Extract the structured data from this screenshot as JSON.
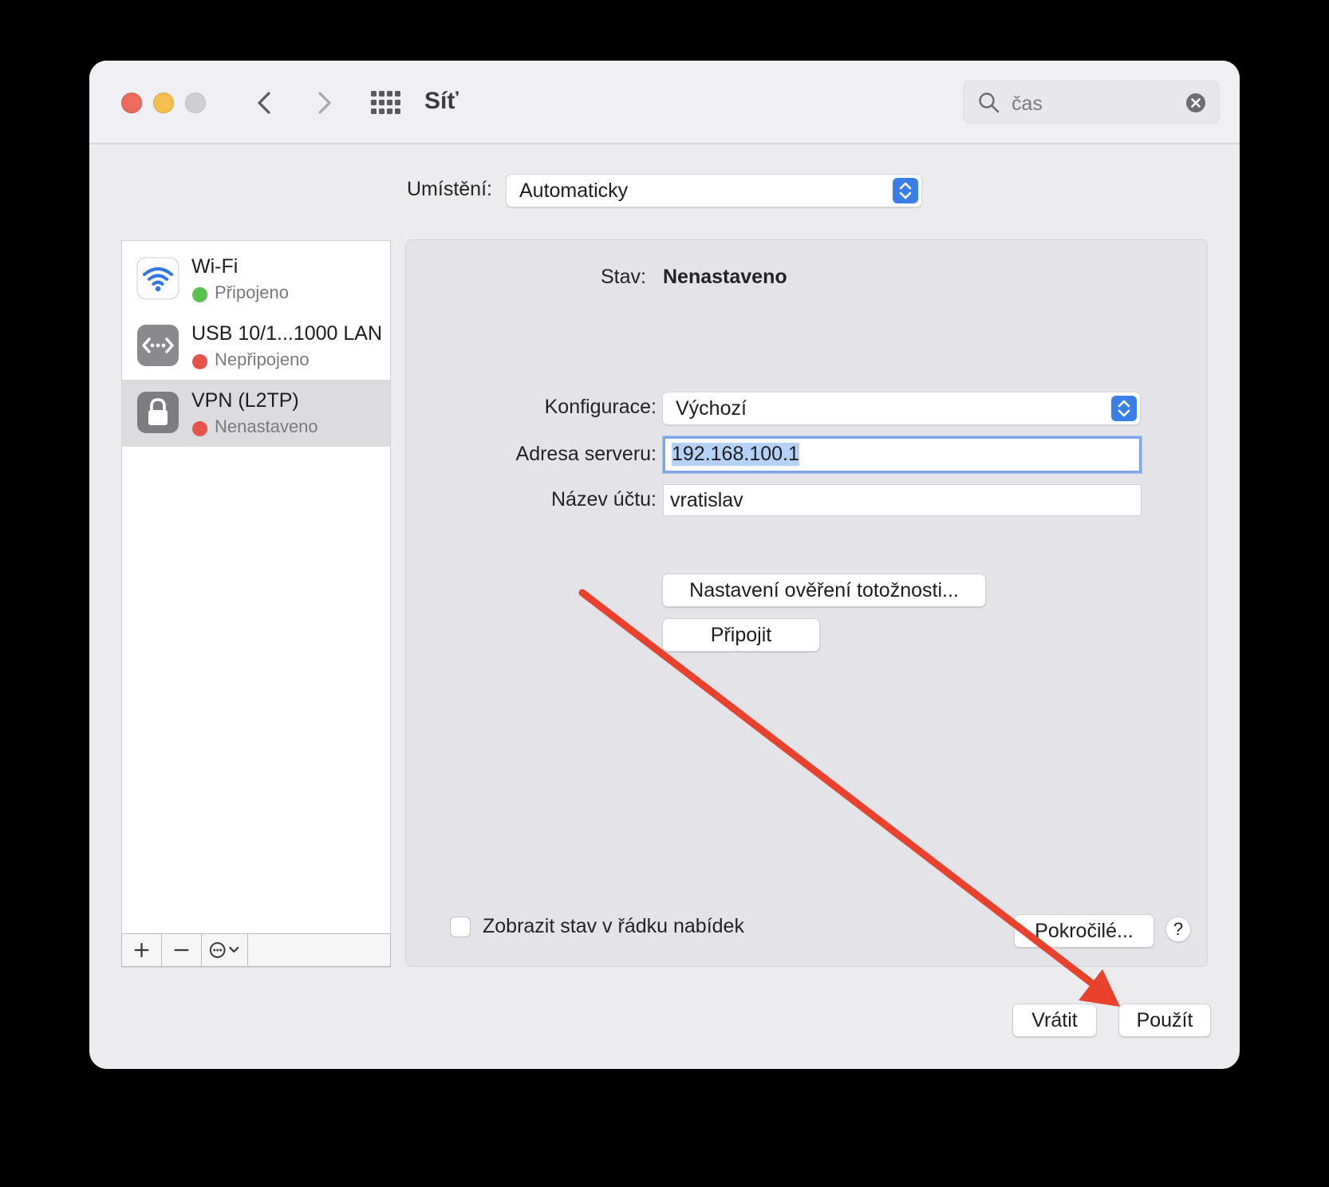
{
  "window": {
    "title": "Síť"
  },
  "search": {
    "value": "čas"
  },
  "location": {
    "label": "Umístění:",
    "value": "Automaticky"
  },
  "services": [
    {
      "name": "Wi-Fi",
      "status": "Připojeno",
      "status_color": "#5bc24f",
      "icon": "wifi-icon"
    },
    {
      "name": "USB 10/1...1000 LAN",
      "status": "Nepřipojeno",
      "status_color": "#e5534b",
      "icon": "ethernet-icon"
    },
    {
      "name": "VPN (L2TP)",
      "status": "Nenastaveno",
      "status_color": "#e5534b",
      "icon": "lock-icon",
      "selected": true
    }
  ],
  "detail": {
    "status_label": "Stav:",
    "status_value": "Nenastaveno",
    "config_label": "Konfigurace:",
    "config_value": "Výchozí",
    "server_label": "Adresa serveru:",
    "server_value": "192.168.100.1",
    "account_label": "Název účtu:",
    "account_value": "vratislav",
    "auth_button": "Nastavení ověření totožnosti...",
    "connect_button": "Připojit",
    "show_status_label": "Zobrazit stav v řádku nabídek",
    "show_status_checked": false,
    "advanced_button": "Pokročilé...",
    "help_button": "?"
  },
  "footer": {
    "revert_button": "Vrátit",
    "apply_button": "Použít"
  },
  "colors": {
    "accent": "#3a7ee8",
    "annotation_arrow": "#e8412c"
  }
}
